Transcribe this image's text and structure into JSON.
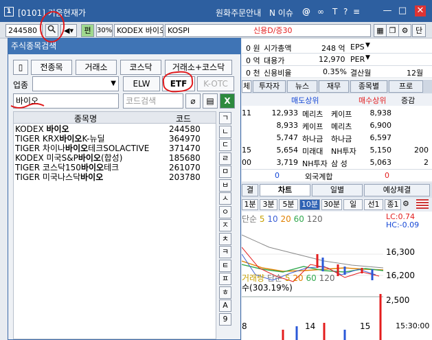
{
  "titlebar": {
    "number": "1",
    "title": "[0101] 키움현재가",
    "order_info": "원화주문안내",
    "issue": "N 이슈",
    "min": "—",
    "max": "□",
    "close": "✕"
  },
  "toolbar": {
    "code": "244580",
    "pill": "편",
    "pct": "30%",
    "name": "KODEX 바이오",
    "market": "KOSPI",
    "credit": "신용D/증30",
    "btn_single": "단"
  },
  "bg_info": {
    "rows": [
      {
        "a": "0 원",
        "b": "시가총액",
        "c": "248 억",
        "d": "EPS"
      },
      {
        "a": "0 억",
        "b": "대용가",
        "c": "12,970",
        "d": "PER"
      },
      {
        "a": "0 천",
        "b": "신용비율",
        "c": "0.35%",
        "d": "결산월",
        "e": "12월"
      }
    ]
  },
  "bg_tabs": [
    "체",
    "투자자",
    "뉴스",
    "재무",
    "종목별",
    "프로"
  ],
  "trade": {
    "header_sell": "매도상위",
    "header_buy": "매수상위",
    "header_change": "증감",
    "rows": [
      {
        "q1": "12,933",
        "s": "메리츠",
        "b": "케이프",
        "q2": "8,938",
        "ch": ""
      },
      {
        "q1": "8,933",
        "s": "케이프",
        "b": "메리츠",
        "q2": "6,900",
        "ch": ""
      },
      {
        "q1": "5,747",
        "s": "하나금",
        "b": "하나금",
        "q2": "6,597",
        "ch": ""
      },
      {
        "q1": "5,654",
        "s": "미래대",
        "b": "NH투자",
        "q2": "5,150",
        "ch": "200"
      },
      {
        "q1": "3,719",
        "s": "NH투자",
        "b": "삼 성",
        "q2": "5,063",
        "ch": "2"
      }
    ],
    "left_stubs": [
      "11",
      "15",
      "00"
    ],
    "foreign_label": "외국계합",
    "foreign_left": "0",
    "foreign_right": "0"
  },
  "chart_tabs": [
    "결",
    "차트",
    "일별",
    "예상체결"
  ],
  "period_buttons": [
    "1분",
    "3분",
    "5분",
    "10분",
    "30분",
    "일",
    "선1",
    "종1"
  ],
  "chart": {
    "ma_label": "단순",
    "ma": [
      "5",
      "10",
      "20",
      "60",
      "120"
    ],
    "lc": "LC:0.74",
    "hc": "HC:-0.09",
    "prices": [
      "16,300",
      "16,200",
      "2,500"
    ],
    "vol_label": "거래량",
    "vol_ma_label": "단순",
    "vol_ma": [
      "5",
      "20",
      "60",
      "120"
    ],
    "vol_text": "수(303.19%)",
    "dates": [
      "8",
      "14",
      "15",
      "15:30:00"
    ]
  },
  "popup": {
    "title": "주식종목검색",
    "btn_all": "전종목",
    "btn_exchange": "거래소",
    "btn_kosdaq": "코스닥",
    "btn_both": "거래소+코스닥",
    "sector_label": "업종",
    "btn_elw": "ELW",
    "btn_etf": "ETF",
    "btn_kotc": "K-OTC",
    "search_value": "바이오",
    "code_placeholder": "코드검색",
    "col_name": "종목명",
    "col_code": "코드",
    "items": [
      {
        "pre": "KODEX ",
        "hl": "바이오",
        "post": "",
        "code": "244580"
      },
      {
        "pre": "TIGER KRX",
        "hl": "바이오",
        "post": "K-뉴딜",
        "code": "364970"
      },
      {
        "pre": "TIGER 차이나",
        "hl": "바이오",
        "post": "테크SOLACTIVE",
        "code": "371470"
      },
      {
        "pre": "KODEX 미국S&P",
        "hl": "바이오",
        "post": "(합성)",
        "code": "185680"
      },
      {
        "pre": "TIGER 코스닥150",
        "hl": "바이오",
        "post": "테크",
        "code": "261070"
      },
      {
        "pre": "TIGER 미국나스닥",
        "hl": "바이오",
        "post": "",
        "code": "203780"
      }
    ],
    "kor_keys": [
      "ㄱ",
      "ㄴ",
      "ㄷ",
      "ㄹ",
      "ㅁ",
      "ㅂ",
      "ㅅ",
      "ㅇ",
      "ㅈ",
      "ㅊ",
      "ㅋ",
      "ㅌ",
      "ㅍ",
      "ㅎ",
      "A",
      "9"
    ]
  }
}
